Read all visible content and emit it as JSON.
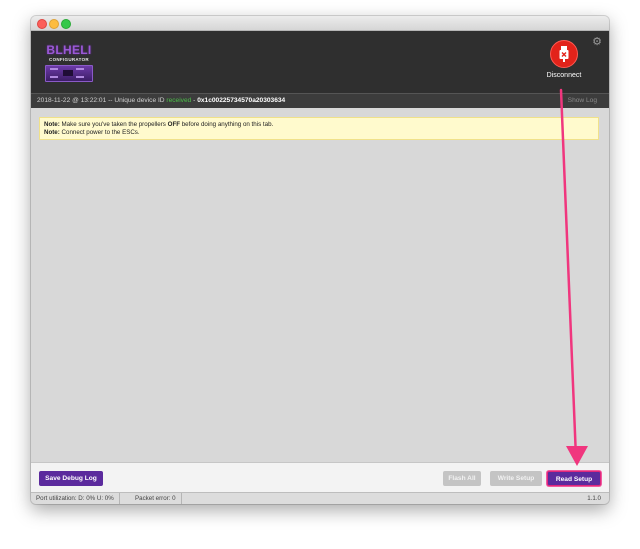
{
  "logo": {
    "title": "BLHELI",
    "subtitle": "CONFIGURATOR"
  },
  "header": {
    "disconnect_label": "Disconnect",
    "accent_color": "#e2231a"
  },
  "log": {
    "timestamp": "2018-11-22 @ 13:22:01",
    "prefix": " -- Unique device ID ",
    "status": "received",
    "separator": " - ",
    "device_id": "0x1c00225734570a20303634",
    "show_log_label": "Show Log"
  },
  "note": {
    "line1_bold": "Note:",
    "line1_a": " Make sure you've taken the propellers ",
    "line1_emph": "OFF",
    "line1_b": " before doing anything on this tab.",
    "line2_bold": "Note:",
    "line2": " Connect power to the ESCs."
  },
  "buttons": {
    "save_debug_log": "Save Debug Log",
    "flash_all": "Flash All",
    "write_setup": "Write Setup",
    "read_setup": "Read Setup",
    "primary_color": "#5b2a9d"
  },
  "footer": {
    "port_utilization": "Port utilization: D: 0% U: 0%",
    "packet_error": "Packet error: 0",
    "version": "1.1.0"
  },
  "annotation": {
    "arrow_color": "#f0367e"
  }
}
